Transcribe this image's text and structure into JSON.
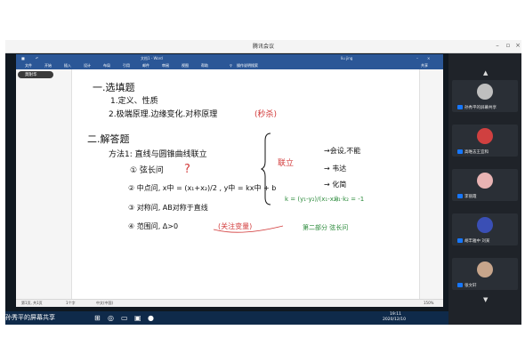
{
  "meeting": {
    "title": "腾讯会议"
  },
  "word": {
    "title": "文档1 - Word",
    "tabs": [
      "文件",
      "开始",
      "插入",
      "设计",
      "布局",
      "引用",
      "邮件",
      "审阅",
      "视图",
      "帮助"
    ],
    "search_hint": "操作说明搜索",
    "user": "liu jing",
    "share_label": "共享"
  },
  "presenter_pill": "莫耐华",
  "notes": {
    "h1": "一.选填题",
    "l1": "1.定义、性质",
    "l2": "2.极端原理.边缘变化.对称原理",
    "l2_note": "(秒杀)",
    "h2": "二.解答题",
    "s1": "方法1: 直线与圆锥曲线联立",
    "i1": "① 弦长问",
    "i1_mark": "?",
    "i2": "② 中点问, x中 = (x₁+x₂)/2 , y中 = kx中 + b",
    "i3": "③ 对称问, AB对称于直线",
    "i4": "④ 范围问, Δ>0",
    "i4_note": "(关注变量)",
    "bracket": "联立",
    "r1": "→会设,不能",
    "r2": "→ 韦达",
    "r3": "→ 化简",
    "k1": "k = (y₁-y₂)/(x₁-x₂)",
    "k2": "k₁·k₂ = -1",
    "k3": "第二部分 弦长问"
  },
  "status": {
    "left": "第1页, 共1页",
    "words": "1个字",
    "lang": "中文(中国)",
    "zoom": "150%"
  },
  "taskbar": {
    "share_text": "孙秀平的屏幕共享",
    "time": "19:11",
    "date": "2020/12/10"
  },
  "participants": [
    {
      "name": "孙秀平的屏幕共享",
      "avatar_color": "#bfbfbf"
    },
    {
      "name": "高唯志王宜和",
      "avatar_color": "#d04040"
    },
    {
      "name": "李丽霞",
      "avatar_color": "#e8b3b3"
    },
    {
      "name": "胡丰雅中 刘某",
      "avatar_color": "#3a4fb5"
    },
    {
      "name": "张文轩",
      "avatar_color": "#c7a58b"
    }
  ]
}
